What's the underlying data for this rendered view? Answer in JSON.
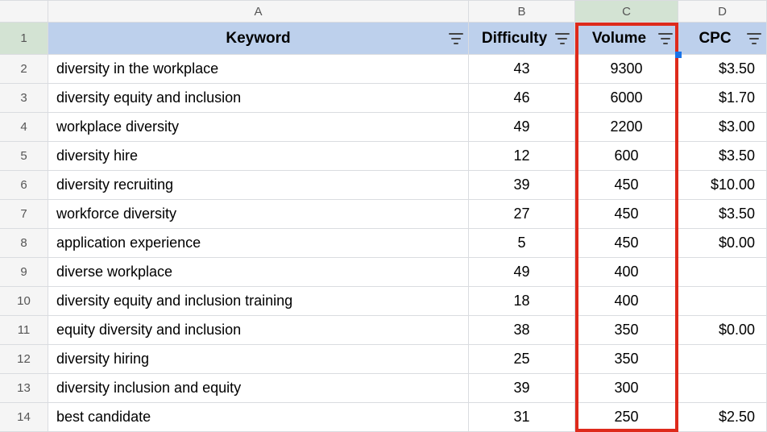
{
  "columns": {
    "letters": [
      "A",
      "B",
      "C",
      "D"
    ],
    "headers": [
      "Keyword",
      "Difficulty",
      "Volume",
      "CPC"
    ]
  },
  "rows": [
    {
      "n": "2",
      "keyword": "diversity in the workplace",
      "difficulty": "43",
      "volume": "9300",
      "cpc": "$3.50"
    },
    {
      "n": "3",
      "keyword": "diversity equity and inclusion",
      "difficulty": "46",
      "volume": "6000",
      "cpc": "$1.70"
    },
    {
      "n": "4",
      "keyword": "workplace diversity",
      "difficulty": "49",
      "volume": "2200",
      "cpc": "$3.00"
    },
    {
      "n": "5",
      "keyword": "diversity hire",
      "difficulty": "12",
      "volume": "600",
      "cpc": "$3.50"
    },
    {
      "n": "6",
      "keyword": "diversity recruiting",
      "difficulty": "39",
      "volume": "450",
      "cpc": "$10.00"
    },
    {
      "n": "7",
      "keyword": "workforce diversity",
      "difficulty": "27",
      "volume": "450",
      "cpc": "$3.50"
    },
    {
      "n": "8",
      "keyword": "application experience",
      "difficulty": "5",
      "volume": "450",
      "cpc": "$0.00"
    },
    {
      "n": "9",
      "keyword": "diverse workplace",
      "difficulty": "49",
      "volume": "400",
      "cpc": ""
    },
    {
      "n": "10",
      "keyword": "diversity equity and inclusion training",
      "difficulty": "18",
      "volume": "400",
      "cpc": ""
    },
    {
      "n": "11",
      "keyword": "equity diversity and inclusion",
      "difficulty": "38",
      "volume": "350",
      "cpc": "$0.00"
    },
    {
      "n": "12",
      "keyword": "diversity hiring",
      "difficulty": "25",
      "volume": "350",
      "cpc": ""
    },
    {
      "n": "13",
      "keyword": "diversity inclusion and equity",
      "difficulty": "39",
      "volume": "300",
      "cpc": ""
    },
    {
      "n": "14",
      "keyword": "best candidate",
      "difficulty": "31",
      "volume": "250",
      "cpc": "$2.50"
    }
  ],
  "chart_data": {
    "type": "table",
    "title": "Keyword data",
    "columns": [
      "Keyword",
      "Difficulty",
      "Volume",
      "CPC"
    ],
    "rows": [
      [
        "diversity in the workplace",
        43,
        9300,
        3.5
      ],
      [
        "diversity equity and inclusion",
        46,
        6000,
        1.7
      ],
      [
        "workplace diversity",
        49,
        2200,
        3.0
      ],
      [
        "diversity hire",
        12,
        600,
        3.5
      ],
      [
        "diversity recruiting",
        39,
        450,
        10.0
      ],
      [
        "workforce diversity",
        27,
        450,
        3.5
      ],
      [
        "application experience",
        5,
        450,
        0.0
      ],
      [
        "diverse workplace",
        49,
        400,
        null
      ],
      [
        "diversity equity and inclusion training",
        18,
        400,
        null
      ],
      [
        "equity diversity and inclusion",
        38,
        350,
        0.0
      ],
      [
        "diversity hiring",
        25,
        350,
        null
      ],
      [
        "diversity inclusion and equity",
        39,
        300,
        null
      ],
      [
        "best candidate",
        31,
        250,
        2.5
      ]
    ]
  }
}
